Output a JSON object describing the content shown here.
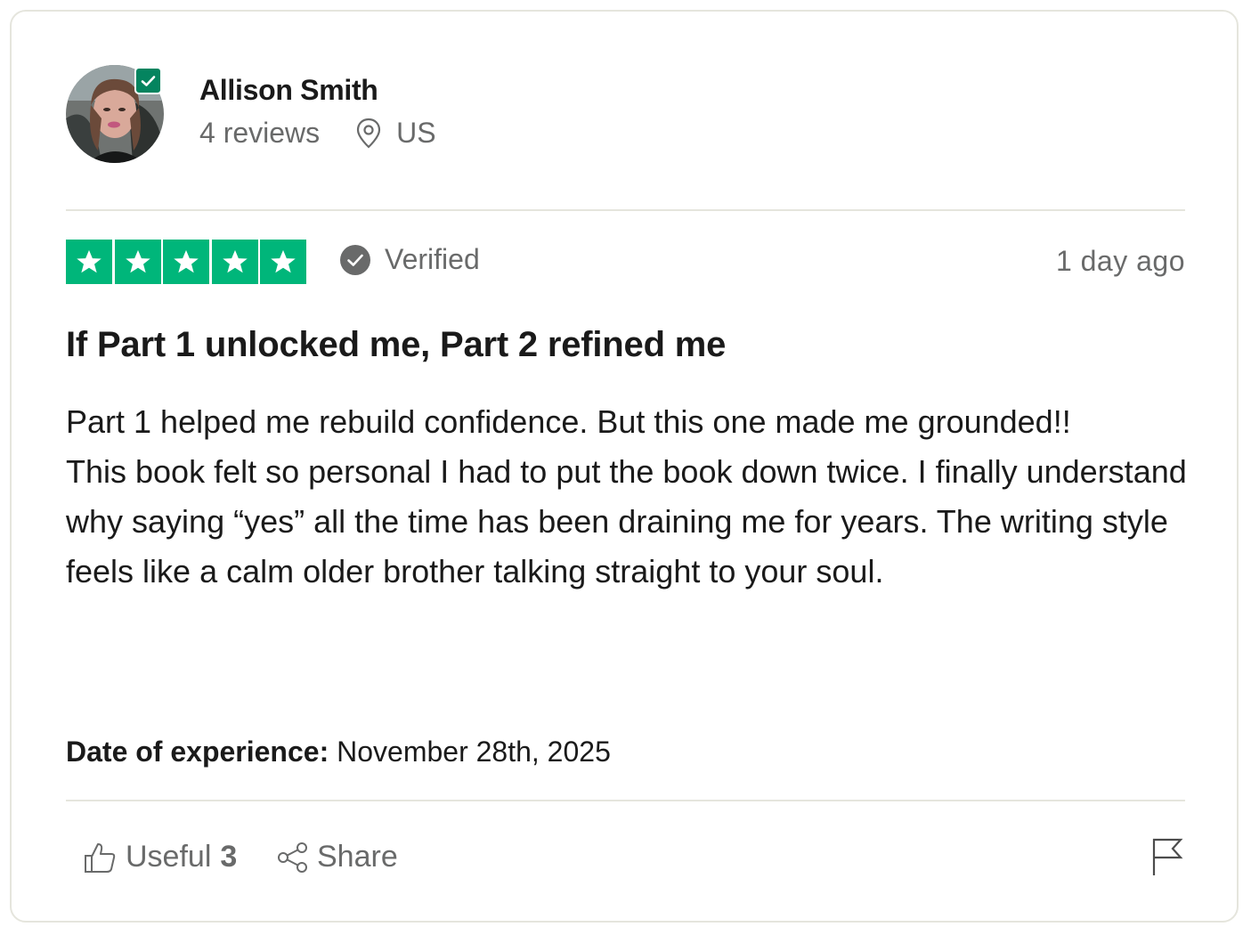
{
  "reviewer": {
    "name": "Allison Smith",
    "review_count": "4 reviews",
    "location": "US",
    "avatar_icon": "user-avatar-photo",
    "badge_icon": "verified-check-icon"
  },
  "rating": {
    "stars": 5,
    "max_stars": 5,
    "star_color": "#00b67a",
    "verified_label": "Verified",
    "posted": "1 day ago"
  },
  "review": {
    "title": "If Part 1 unlocked me, Part 2 refined me",
    "body": "Part 1 helped me rebuild confidence. But this one made me grounded!!\nThis book felt so personal I had to put the book down twice. I finally understand why saying “yes” all the time has been draining me for years. The writing style feels like a calm older brother talking straight to your soul."
  },
  "experience": {
    "label": "Date of experience:",
    "value": "November 28th, 2025"
  },
  "actions": {
    "useful_label": "Useful",
    "useful_count": "3",
    "share_label": "Share",
    "useful_icon": "thumbs-up-icon",
    "share_icon": "share-icon",
    "flag_icon": "flag-icon"
  },
  "colors": {
    "brand_green": "#00b67a",
    "badge_green": "#04845f",
    "muted_text": "#696a6a",
    "divider": "#e5e5dd"
  }
}
